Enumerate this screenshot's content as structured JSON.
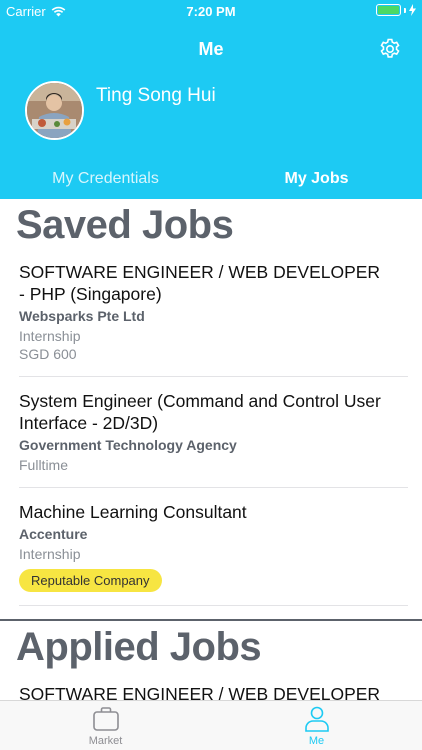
{
  "status_bar": {
    "carrier": "Carrier",
    "time": "7:20 PM"
  },
  "nav": {
    "title": "Me"
  },
  "profile": {
    "name": "Ting Song Hui"
  },
  "tabs": [
    {
      "label": "My Credentials",
      "active": false
    },
    {
      "label": "My Jobs",
      "active": true
    }
  ],
  "saved_jobs": {
    "title": "Saved Jobs",
    "items": [
      {
        "title": "SOFTWARE ENGINEER / WEB DEVELOPER - PHP (Singapore)",
        "company": "Websparks Pte Ltd",
        "type": "Internship",
        "salary": "SGD 600"
      },
      {
        "title": "System Engineer (Command and Control User Interface - 2D/3D)",
        "company": "Government Technology Agency",
        "type": "Fulltime"
      },
      {
        "title": "Machine Learning Consultant",
        "company": "Accenture",
        "type": "Internship",
        "badge": "Reputable Company"
      }
    ]
  },
  "applied_jobs": {
    "title": "Applied Jobs",
    "items": [
      {
        "title": "SOFTWARE ENGINEER / WEB DEVELOPER -"
      }
    ]
  },
  "tab_bar": [
    {
      "label": "Market",
      "icon": "briefcase-icon",
      "active": false
    },
    {
      "label": "Me",
      "icon": "person-icon",
      "active": true
    }
  ],
  "colors": {
    "accent": "#1dcaf3",
    "section_title": "#5c626b",
    "badge": "#f7e542",
    "battery": "#4cd964"
  }
}
